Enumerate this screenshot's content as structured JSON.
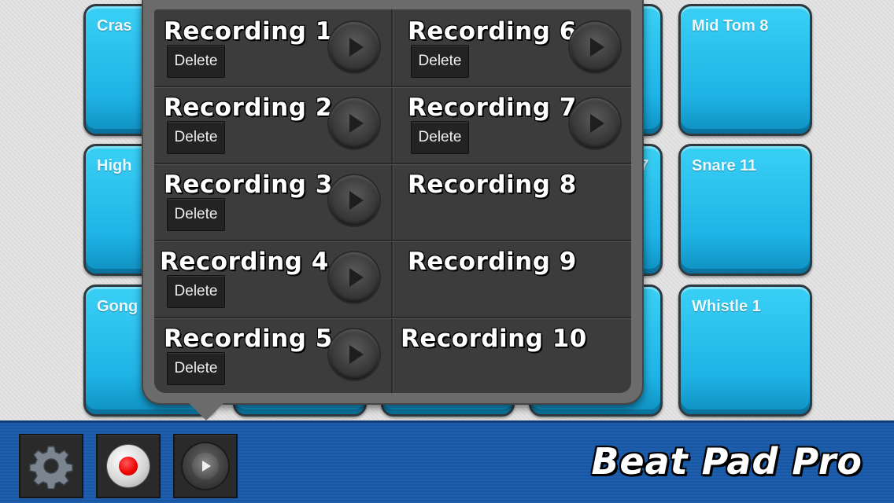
{
  "pads": [
    {
      "label": "Cras"
    },
    {
      "label": "High"
    },
    {
      "label": "Gong"
    },
    {
      "label": "Mid Tom 8"
    },
    {
      "label": "Snare 11"
    },
    {
      "label": "Whistle 1"
    },
    {
      "label": "7"
    }
  ],
  "recordings": [
    {
      "title": "Recording 1",
      "delete": "Delete"
    },
    {
      "title": "Recording 2",
      "delete": "Delete"
    },
    {
      "title": "Recording 3",
      "delete": "Delete"
    },
    {
      "title": "Recording 4",
      "delete": "Delete"
    },
    {
      "title": "Recording 5",
      "delete": "Delete"
    },
    {
      "title": "Recording 6",
      "delete": "Delete"
    },
    {
      "title": "Recording 7",
      "delete": "Delete"
    },
    {
      "title": "Recording 8"
    },
    {
      "title": "Recording 9"
    },
    {
      "title": "Recording 10"
    }
  ],
  "toolbar": {
    "settings_icon": "gear-icon",
    "record_icon": "record-icon",
    "play_icon": "play-icon"
  },
  "brand": {
    "title": "Beat Pad Pro"
  },
  "colors": {
    "pad": "#1fb3e6",
    "bar": "#1d5fae",
    "popup": "#3c3c3c",
    "record": "#e00000"
  }
}
